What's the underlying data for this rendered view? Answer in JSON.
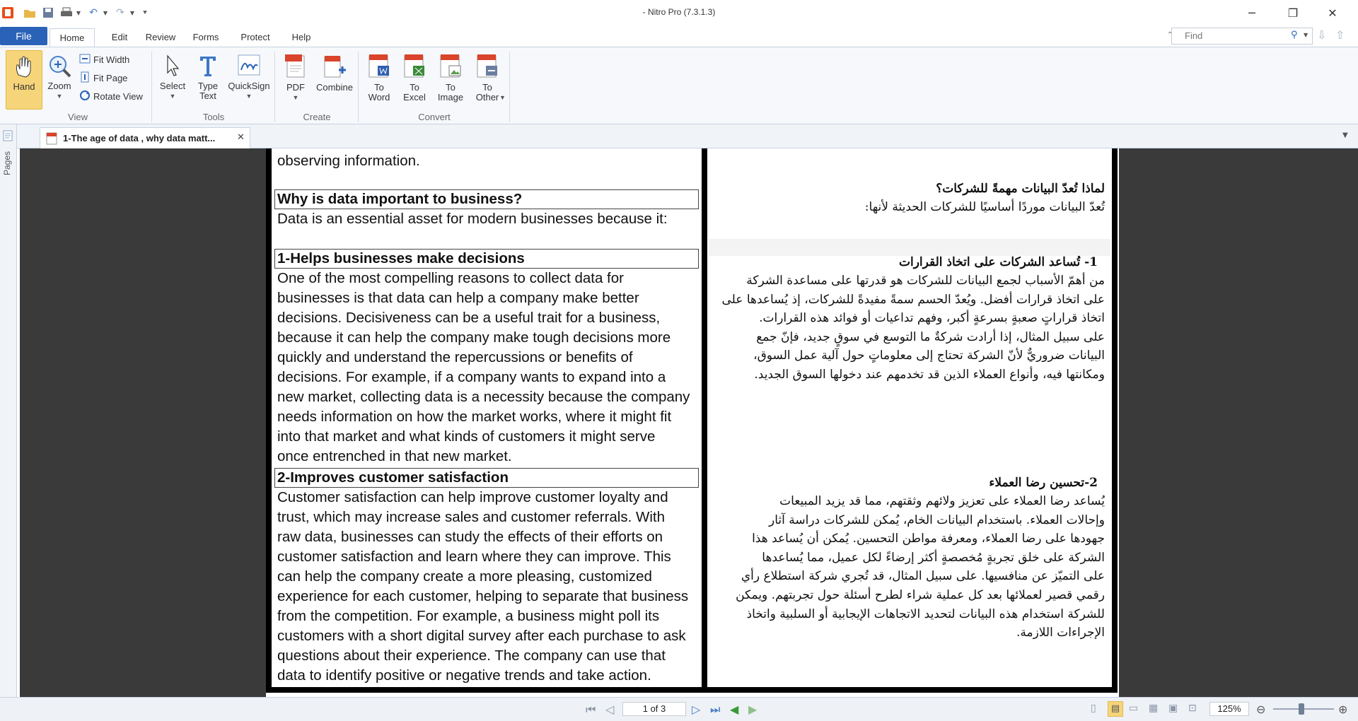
{
  "window": {
    "title": "- Nitro Pro (7.3.1.3)",
    "minimize": "─",
    "restore": "❐",
    "close": "✕"
  },
  "menu": {
    "tabs": [
      "File",
      "Home",
      "Edit",
      "Review",
      "Forms",
      "Protect",
      "Help"
    ],
    "find_placeholder": "Find"
  },
  "ribbon": {
    "view": {
      "label": "View",
      "hand": "Hand",
      "zoom": "Zoom",
      "fit_width": "Fit Width",
      "fit_page": "Fit Page",
      "rotate_view": "Rotate View"
    },
    "tools": {
      "label": "Tools",
      "select": "Select",
      "type_text": [
        "Type",
        "Text"
      ],
      "quicksign": "QuickSign"
    },
    "create": {
      "label": "Create",
      "pdf": "PDF",
      "combine": "Combine"
    },
    "convert": {
      "label": "Convert",
      "to_word": [
        "To",
        "Word"
      ],
      "to_excel": [
        "To",
        "Excel"
      ],
      "to_image": [
        "To",
        "Image"
      ],
      "to_other": [
        "To",
        "Other"
      ]
    }
  },
  "document_tab": {
    "title": "1-The age of data , why data matt..."
  },
  "side_panel": {
    "label": "Pages"
  },
  "document": {
    "english": {
      "line_observing": "observing information.",
      "h_why": "Why is data important to business?",
      "p_intro": "Data is an essential asset for modern businesses because it:",
      "h_1": "1-Helps businesses make decisions",
      "p_1": [
        "One of the most compelling reasons to collect data for",
        "businesses is that data can help a company make better",
        "decisions. Decisiveness can be a useful trait for a business,",
        "because it can help the company make tough decisions more",
        "quickly and understand the repercussions or benefits of",
        "decisions. For example, if a company wants to expand into a",
        "new market, collecting data is a necessity because the company",
        "needs information on how the market works, where it might fit",
        "into that market and what kinds of customers it might serve",
        "once entrenched in that new market."
      ],
      "h_2": "2-Improves customer satisfaction",
      "p_2": [
        "Customer satisfaction can help improve customer loyalty and",
        "trust, which may increase sales and customer referrals. With",
        "raw data, businesses can study the effects of their efforts on",
        "customer satisfaction and learn where they can improve. This",
        "can help the company create a more pleasing, customized",
        "experience for each customer, helping to separate that business",
        "from the competition. For example, a business might poll its",
        "customers with a short digital survey after each purchase to ask",
        "questions about their experience. The company can use that",
        "data to identify positive or negative trends and take action."
      ]
    },
    "arabic": {
      "h_why": "لماذا تُعدّ البيانات مهمةً للشركات؟",
      "p_intro": "تُعدّ البيانات موردًا أساسيًا للشركات الحديثة لأنها:",
      "h_1": "1-   تُساعد الشركات على اتخاذ القرارات",
      "p_1": [
        "من أهمّ الأسباب لجمع البيانات للشركات هو قدرتها على مساعدة الشركة",
        "على اتخاذ قرارات أفضل. ويُعدّ الحسم سمةً مفيدةً للشركات، إذ يُساعدها على",
        "اتخاذ قراراتٍ صعبةٍ بسرعةٍ أكبر، وفهم تداعيات أو فوائد هذه القرارات.",
        "على سبيل المثال، إذا أرادت شركةٌ ما التوسع في سوقٍ جديد، فإنّ جمع",
        "البيانات ضروريٌّ لأنّ الشركة تحتاج إلى معلوماتٍ حول آلية عمل السوق،",
        "ومكانتها فيه، وأنواع العملاء الذين قد تخدمهم عند دخولها السوق الجديد."
      ],
      "h_2": "2-تحسين رضا العملاء",
      "p_2": [
        "يُساعد رضا العملاء على تعزيز ولائهم وثقتهم، مما قد يزيد المبيعات",
        "وإحالات العملاء. باستخدام البيانات الخام، يُمكن للشركات دراسة آثار",
        "جهودها على رضا العملاء، ومعرفة مواطن التحسين. يُمكن أن يُساعد هذا",
        "الشركة على خلق تجربةٍ مُخصصةٍ أكثر إرضاءً لكل عميل، مما يُساعدها",
        "على التميّز عن منافسيها. على سبيل المثال، قد تُجري شركة استطلاع رأي",
        "رقمي قصير لعملائها بعد كل عملية شراء لطرح أسئلة حول تجربتهم. ويمكن",
        "للشركة استخدام هذه البيانات لتحديد الاتجاهات الإيجابية أو السلبية واتخاذ",
        "الإجراءات اللازمة."
      ]
    }
  },
  "status": {
    "page_indicator": "1 of 3",
    "zoom": "125%"
  }
}
